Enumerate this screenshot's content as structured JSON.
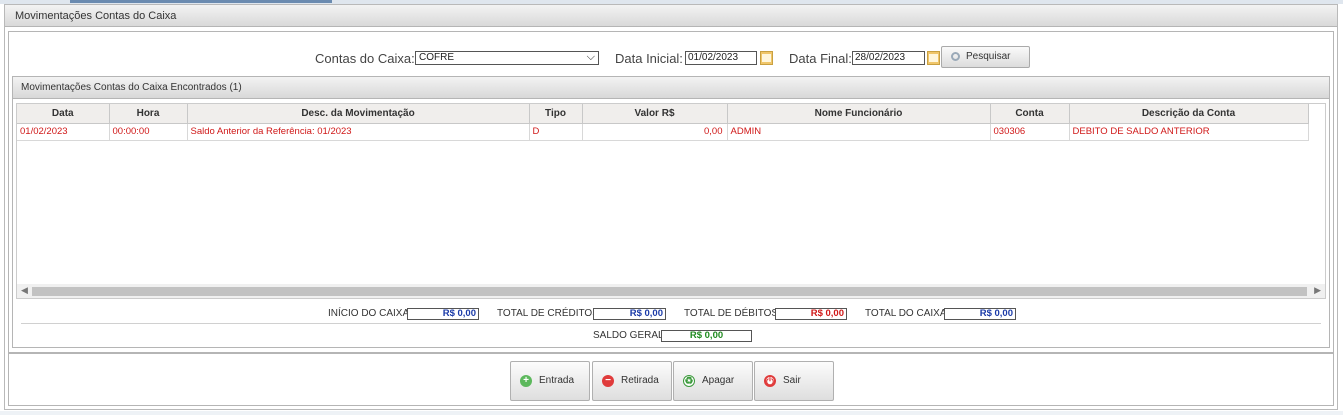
{
  "panel": {
    "title": "Movimentações Contas do Caixa"
  },
  "filters": {
    "contas_label": "Contas do Caixa:",
    "contas_value": "COFRE",
    "data_inicial_label": "Data Inicial:",
    "data_inicial_value": "01/02/2023",
    "data_final_label": "Data Final:",
    "data_final_value": "28/02/2023",
    "search_label": "Pesquisar"
  },
  "results": {
    "title": "Movimentações Contas do Caixa Encontrados (1)",
    "columns": [
      "Data",
      "Hora",
      "Desc. da Movimentação",
      "Tipo",
      "Valor R$",
      "Nome Funcionário",
      "Conta",
      "Descrição da Conta"
    ],
    "rows": [
      [
        "01/02/2023",
        "00:00:00",
        "Saldo Anterior da Referência: 01/2023",
        "D",
        "0,00",
        "ADMIN",
        "030306",
        "DEBITO DE SALDO ANTERIOR"
      ]
    ]
  },
  "totals": {
    "inicio_label": "INÍCIO DO CAIXA:",
    "inicio_value": "R$ 0,00",
    "creditos_label": "TOTAL DE CRÉDITOS:",
    "creditos_value": "R$ 0,00",
    "debitos_label": "TOTAL DE DÉBITOS:",
    "debitos_value": "R$ 0,00",
    "caixa_label": "TOTAL DO CAIXA:",
    "caixa_value": "R$ 0,00",
    "saldo_label": "SALDO GERAL:",
    "saldo_value": "R$ 0,00"
  },
  "actions": {
    "entrada": "Entrada",
    "retirada": "Retirada",
    "apagar": "Apagar",
    "sair": "Sair"
  },
  "colors": {
    "row_text": "#d01818",
    "positive": "#1a3aa8",
    "negative": "#d01818",
    "saldo": "#1f8a1f"
  }
}
